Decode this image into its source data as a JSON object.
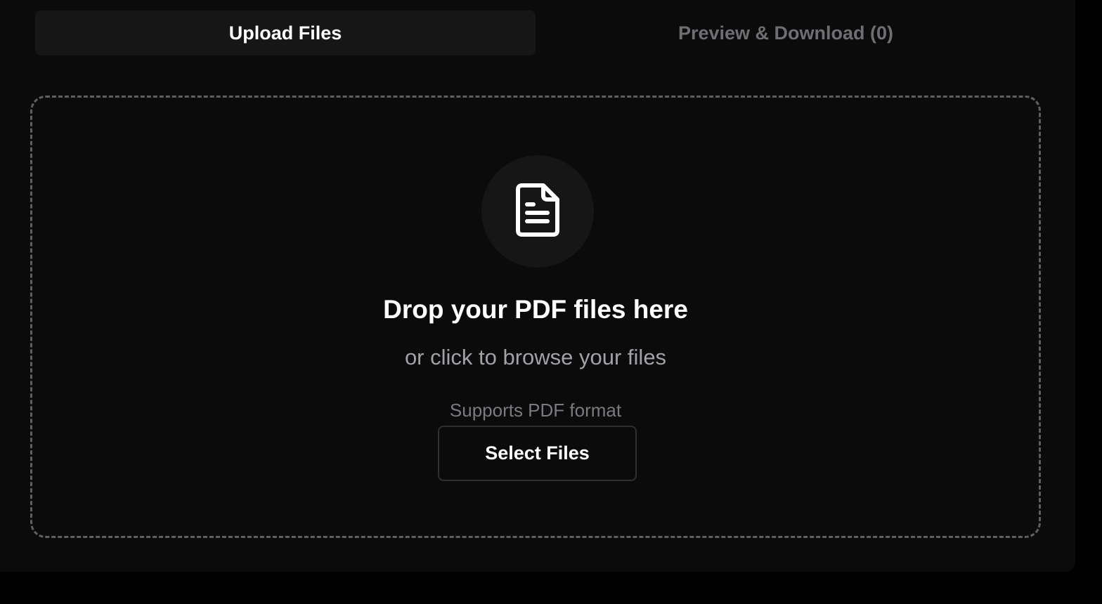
{
  "tabs": [
    {
      "label": "Upload Files",
      "active": true
    },
    {
      "label": "Preview & Download (0)",
      "active": false
    }
  ],
  "dropzone": {
    "icon": "file-text-icon",
    "heading": "Drop your PDF files here",
    "subheading": "or click to browse your files",
    "hint": "Supports PDF format",
    "button_label": "Select Files"
  },
  "colors": {
    "background": "#000000",
    "panel": "#0b0b0b",
    "active_tab": "#161616",
    "inactive_tab_text": "#6e6e73",
    "dashed_border": "#5e5e63",
    "text_primary": "#ffffff",
    "text_secondary": "#a1a1a8",
    "text_muted": "#7a7a80"
  }
}
